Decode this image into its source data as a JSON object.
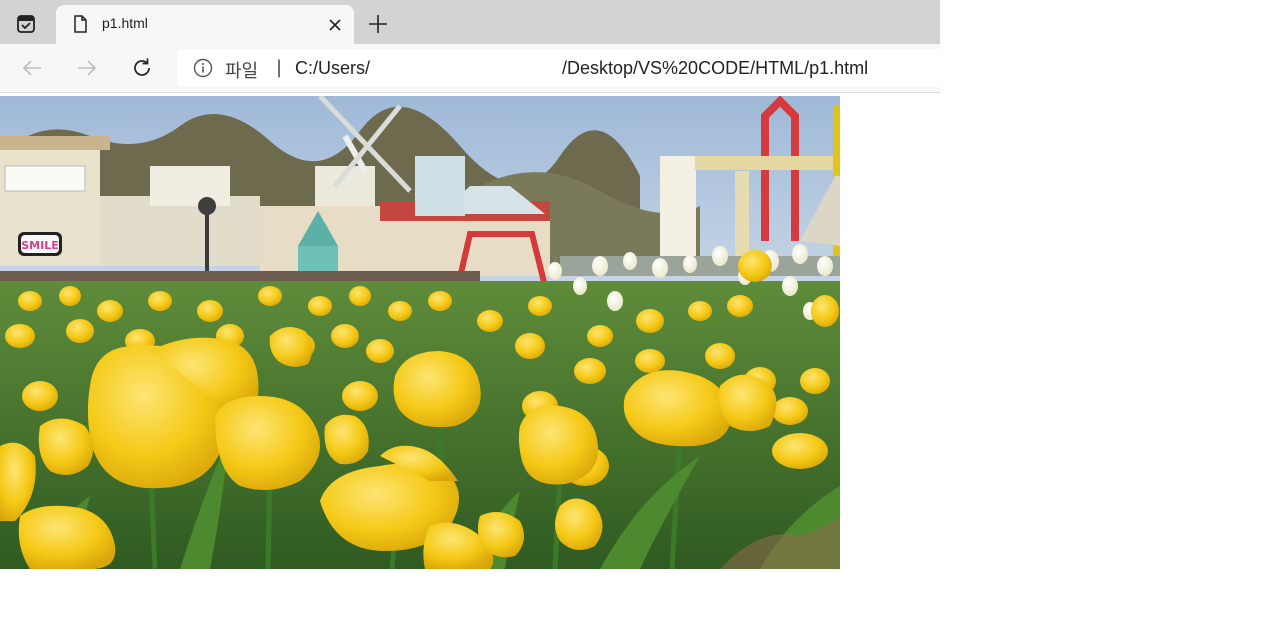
{
  "browser": {
    "tab": {
      "title": "p1.html"
    },
    "address_bar": {
      "scheme_label": "파일",
      "separator": "|",
      "url_start": "C:/Users/",
      "url_end": "/Desktop/VS%20CODE/HTML/p1.html"
    },
    "icons": {
      "tab_actions": "tab-actions-icon",
      "page": "page-icon",
      "close": "close-icon",
      "new_tab": "plus-icon",
      "back": "arrow-left-icon",
      "forward": "arrow-right-icon",
      "reload": "reload-icon",
      "info": "info-icon"
    }
  },
  "page": {
    "image": {
      "subject": "tulip-field-amusement-park",
      "sign_text": "SMILE"
    }
  },
  "colors": {
    "tabstrip": "#d3d3d3",
    "toolbar": "#f7f7f7",
    "tulip": "#f5c916"
  }
}
